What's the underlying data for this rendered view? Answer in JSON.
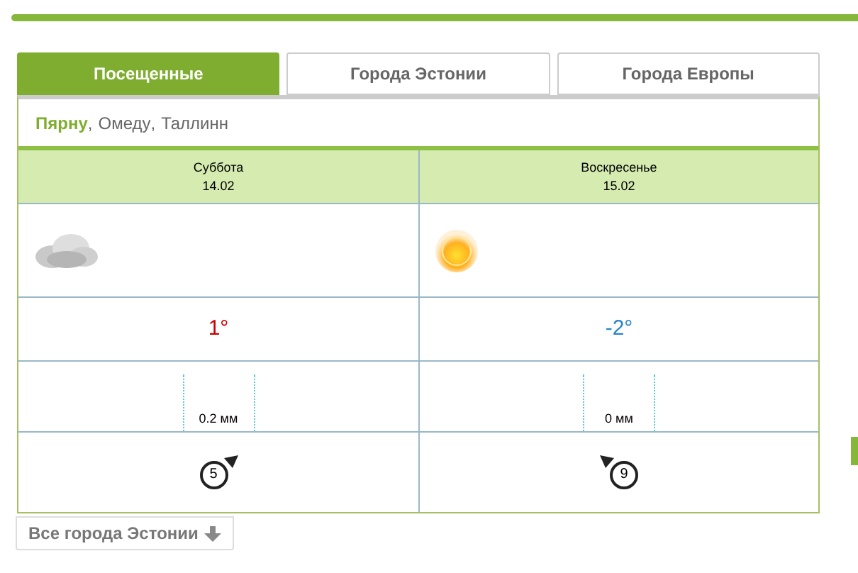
{
  "tabs": [
    {
      "label": "Посещенные",
      "selected": true
    },
    {
      "label": "Города Эстонии",
      "selected": false
    },
    {
      "label": "Города Европы",
      "selected": false
    }
  ],
  "cities": [
    {
      "name": "Пярну",
      "selected": true
    },
    {
      "name": "Омеду",
      "selected": false
    },
    {
      "name": "Таллинн",
      "selected": false
    }
  ],
  "city_separator": ",",
  "days": [
    {
      "day": "Суббота",
      "date": "14.02",
      "weather": {
        "kind": "cloudy"
      },
      "temperature": "1°",
      "color": "#cc0000",
      "precipitation": "0.2 мм",
      "wind": {
        "speed": "5",
        "kind": "arrow_right"
      }
    },
    {
      "day": "Воскресенье",
      "date": "15.02",
      "weather": {
        "kind": "sunny"
      },
      "temperature": "-2°",
      "color": "#2a86c8",
      "precipitation": "0 мм",
      "wind": {
        "speed": "9",
        "kind": "arrow_left"
      }
    }
  ],
  "more_button": "Все города Эстонии"
}
